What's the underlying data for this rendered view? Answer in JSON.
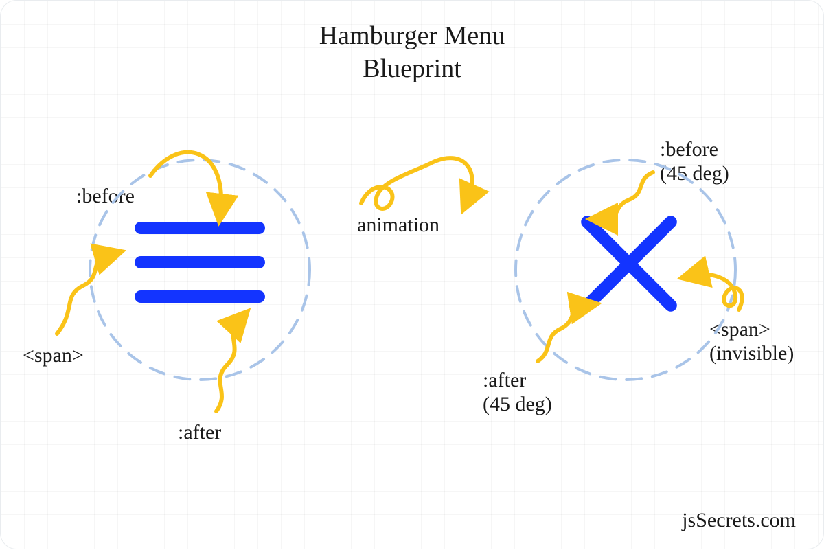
{
  "title_line1": "Hamburger Menu",
  "title_line2": "Blueprint",
  "brand": "jsSecrets.com",
  "center": {
    "animation": "animation"
  },
  "left": {
    "before": ":before",
    "span": "<span>",
    "after": ":after"
  },
  "right": {
    "before_l1": ":before",
    "before_l2": "(45 deg)",
    "after_l1": ":after",
    "after_l2": "(45 deg)",
    "span_l1": "<span>",
    "span_l2": "(invisible)"
  },
  "colors": {
    "bar": "#1334ff",
    "arrow": "#fac318",
    "circle": "#a9c4e8"
  }
}
